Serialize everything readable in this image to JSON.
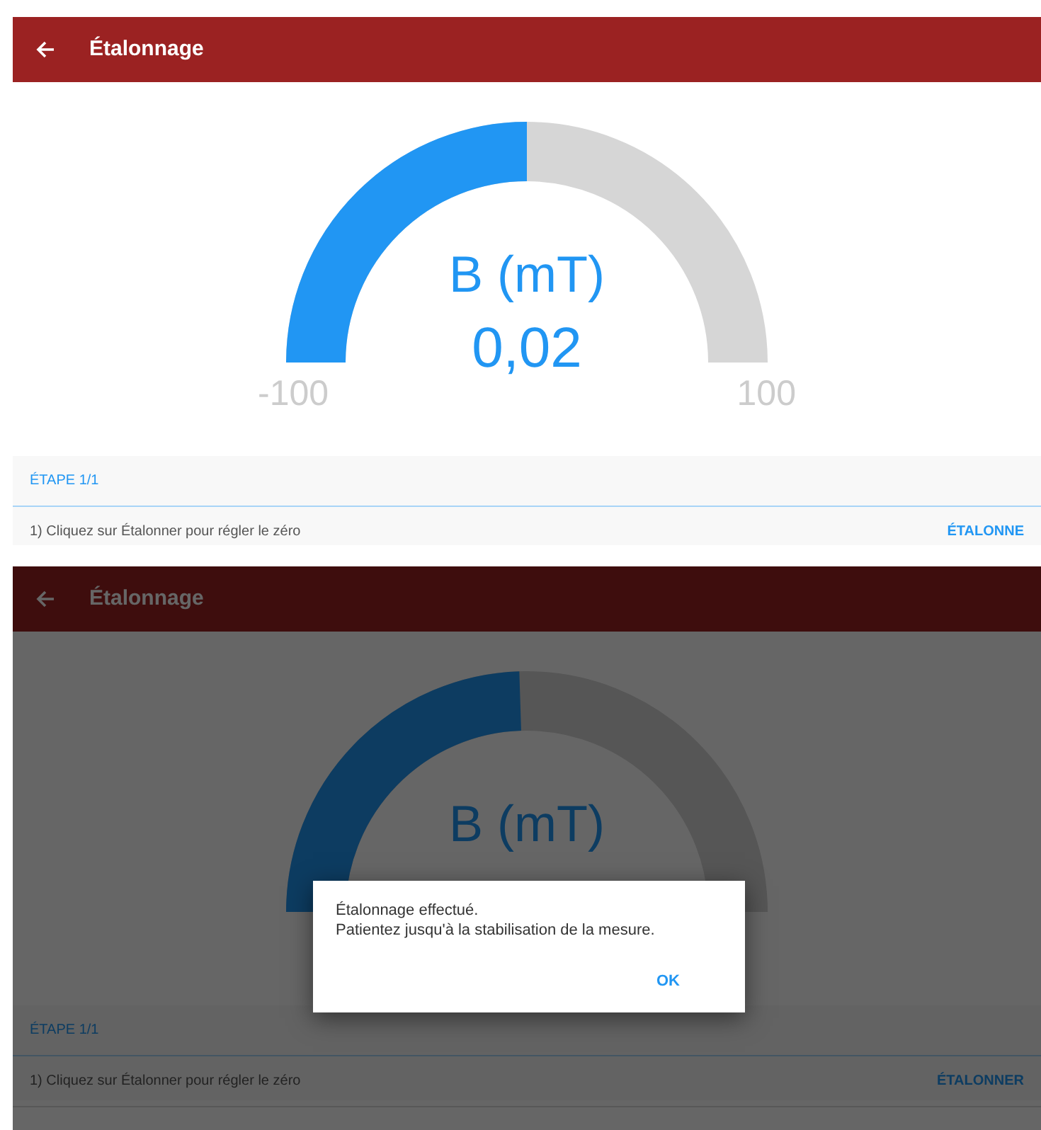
{
  "screens": [
    {
      "app_bar": {
        "title": "Étalonnage"
      },
      "gauge": {
        "label": "B (mT)",
        "value": "0,02",
        "min": "-100",
        "max": "100",
        "level": 0.5
      },
      "step": {
        "header": "ÉTAPE 1/1",
        "instruction": "1) Cliquez sur Étalonner pour régler le zéro",
        "action": "ÉTALONNE"
      }
    },
    {
      "app_bar": {
        "title": "Étalonnage"
      },
      "gauge": {
        "label": "B (mT)",
        "level": 0.49
      },
      "step": {
        "header": "ÉTAPE 1/1",
        "instruction": "1) Cliquez sur Étalonner pour régler le zéro",
        "action": "ÉTALONNER"
      },
      "dialog": {
        "message": [
          "Étalonnage effectué.",
          "Patientez jusqu'à la stabilisation de la mesure."
        ],
        "button": "OK"
      }
    }
  ]
}
